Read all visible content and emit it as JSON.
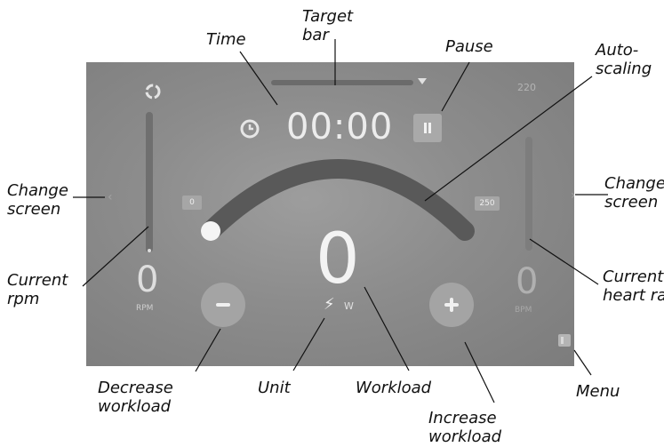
{
  "screen": {
    "time": "00:00",
    "workload_value": "0",
    "unit_label": "W",
    "rpm_value": "0",
    "rpm_unit": "RPM",
    "heart_rate_value": "0",
    "heart_rate_unit": "BPM",
    "heart_rate_top_label": "220",
    "scale_left": "0",
    "scale_right": "250",
    "chevron_left": "‹",
    "chevron_right": "›",
    "unit_icon": "⚡"
  },
  "annotations": {
    "time": "Time",
    "target_bar_line1": "Target",
    "target_bar_line2": "bar",
    "pause": "Pause",
    "auto_scaling_line1": "Auto-",
    "auto_scaling_line2": "scaling",
    "change_screen_left_line1": "Change",
    "change_screen_left_line2": "screen",
    "change_screen_right_line1": "Change",
    "change_screen_right_line2": "screen",
    "current_rpm_line1": "Current",
    "current_rpm_line2": "rpm",
    "current_heart_rate_line1": "Current",
    "current_heart_rate_line2": "heart rate",
    "decrease_workload_line1": "Decrease",
    "decrease_workload_line2": "workload",
    "unit": "Unit",
    "workload": "Workload",
    "increase_workload_line1": "Increase",
    "increase_workload_line2": "workload",
    "menu": "Menu"
  },
  "icons": {
    "clock": "clock-icon",
    "rpm": "rpm-icon",
    "pause": "pause-icon",
    "bolt": "bolt-icon",
    "minus": "minus-icon",
    "plus": "plus-icon",
    "menu": "menu-icon"
  },
  "colors": {
    "screen_bg": "#8c8c8c",
    "text": "#f0f0f0",
    "button_bg": "#a4a4a4",
    "arc": "#555555"
  }
}
